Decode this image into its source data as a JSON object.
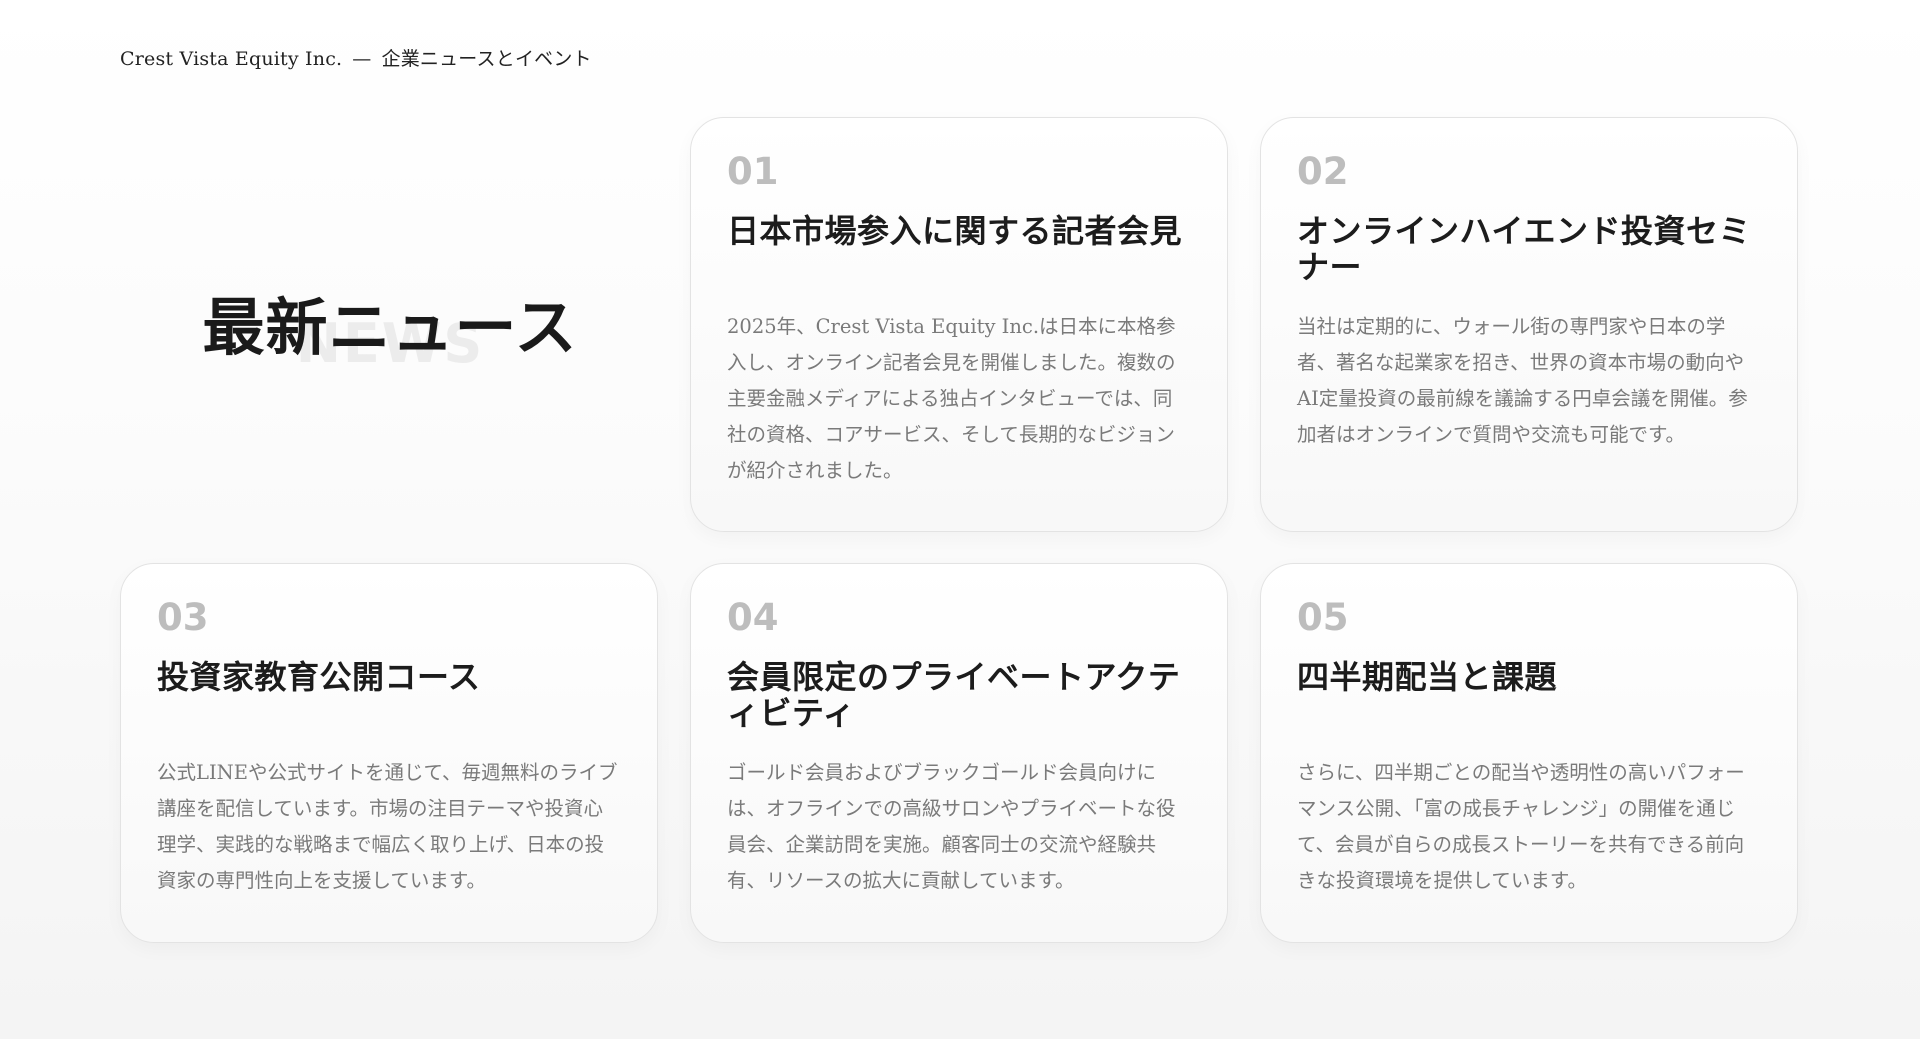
{
  "header": {
    "company": "Crest Vista Equity Inc.",
    "separator": "—",
    "section": "企業ニュースとイベント"
  },
  "hero": {
    "title": "最新ニュース",
    "watermark": "NEWS"
  },
  "cards": [
    {
      "number": "01",
      "title": "日本市場参入に関する記者会見",
      "body": "2025年、Crest Vista Equity Inc.は日本に本格参入し、オンライン記者会見を開催しました。複数の主要金融メディアによる独占インタビューでは、同社の資格、コアサービス、そして長期的なビジョンが紹介されました。"
    },
    {
      "number": "02",
      "title": "オンラインハイエンド投資セミナー",
      "body": "当社は定期的に、ウォール街の専門家や日本の学者、著名な起業家を招き、世界の資本市場の動向やAI定量投資の最前線を議論する円卓会議を開催。参加者はオンラインで質問や交流も可能です。"
    },
    {
      "number": "03",
      "title": "投資家教育公開コース",
      "body": "公式LINEや公式サイトを通じて、毎週無料のライブ講座を配信しています。市場の注目テーマや投資心理学、実践的な戦略まで幅広く取り上げ、日本の投資家の専門性向上を支援しています。"
    },
    {
      "number": "04",
      "title": "会員限定のプライベートアクティビティ",
      "body": "ゴールド会員およびブラックゴールド会員向けには、オフラインでの高級サロンやプライベートな役員会、企業訪問を実施。顧客同士の交流や経験共有、リソースの拡大に貢献しています。"
    },
    {
      "number": "05",
      "title": "四半期配当と課題",
      "body": "さらに、四半期ごとの配当や透明性の高いパフォーマンス公開、「富の成長チャレンジ」の開催を通じて、会員が自らの成長ストーリーを共有できる前向きな投資環境を提供しています。"
    }
  ]
}
